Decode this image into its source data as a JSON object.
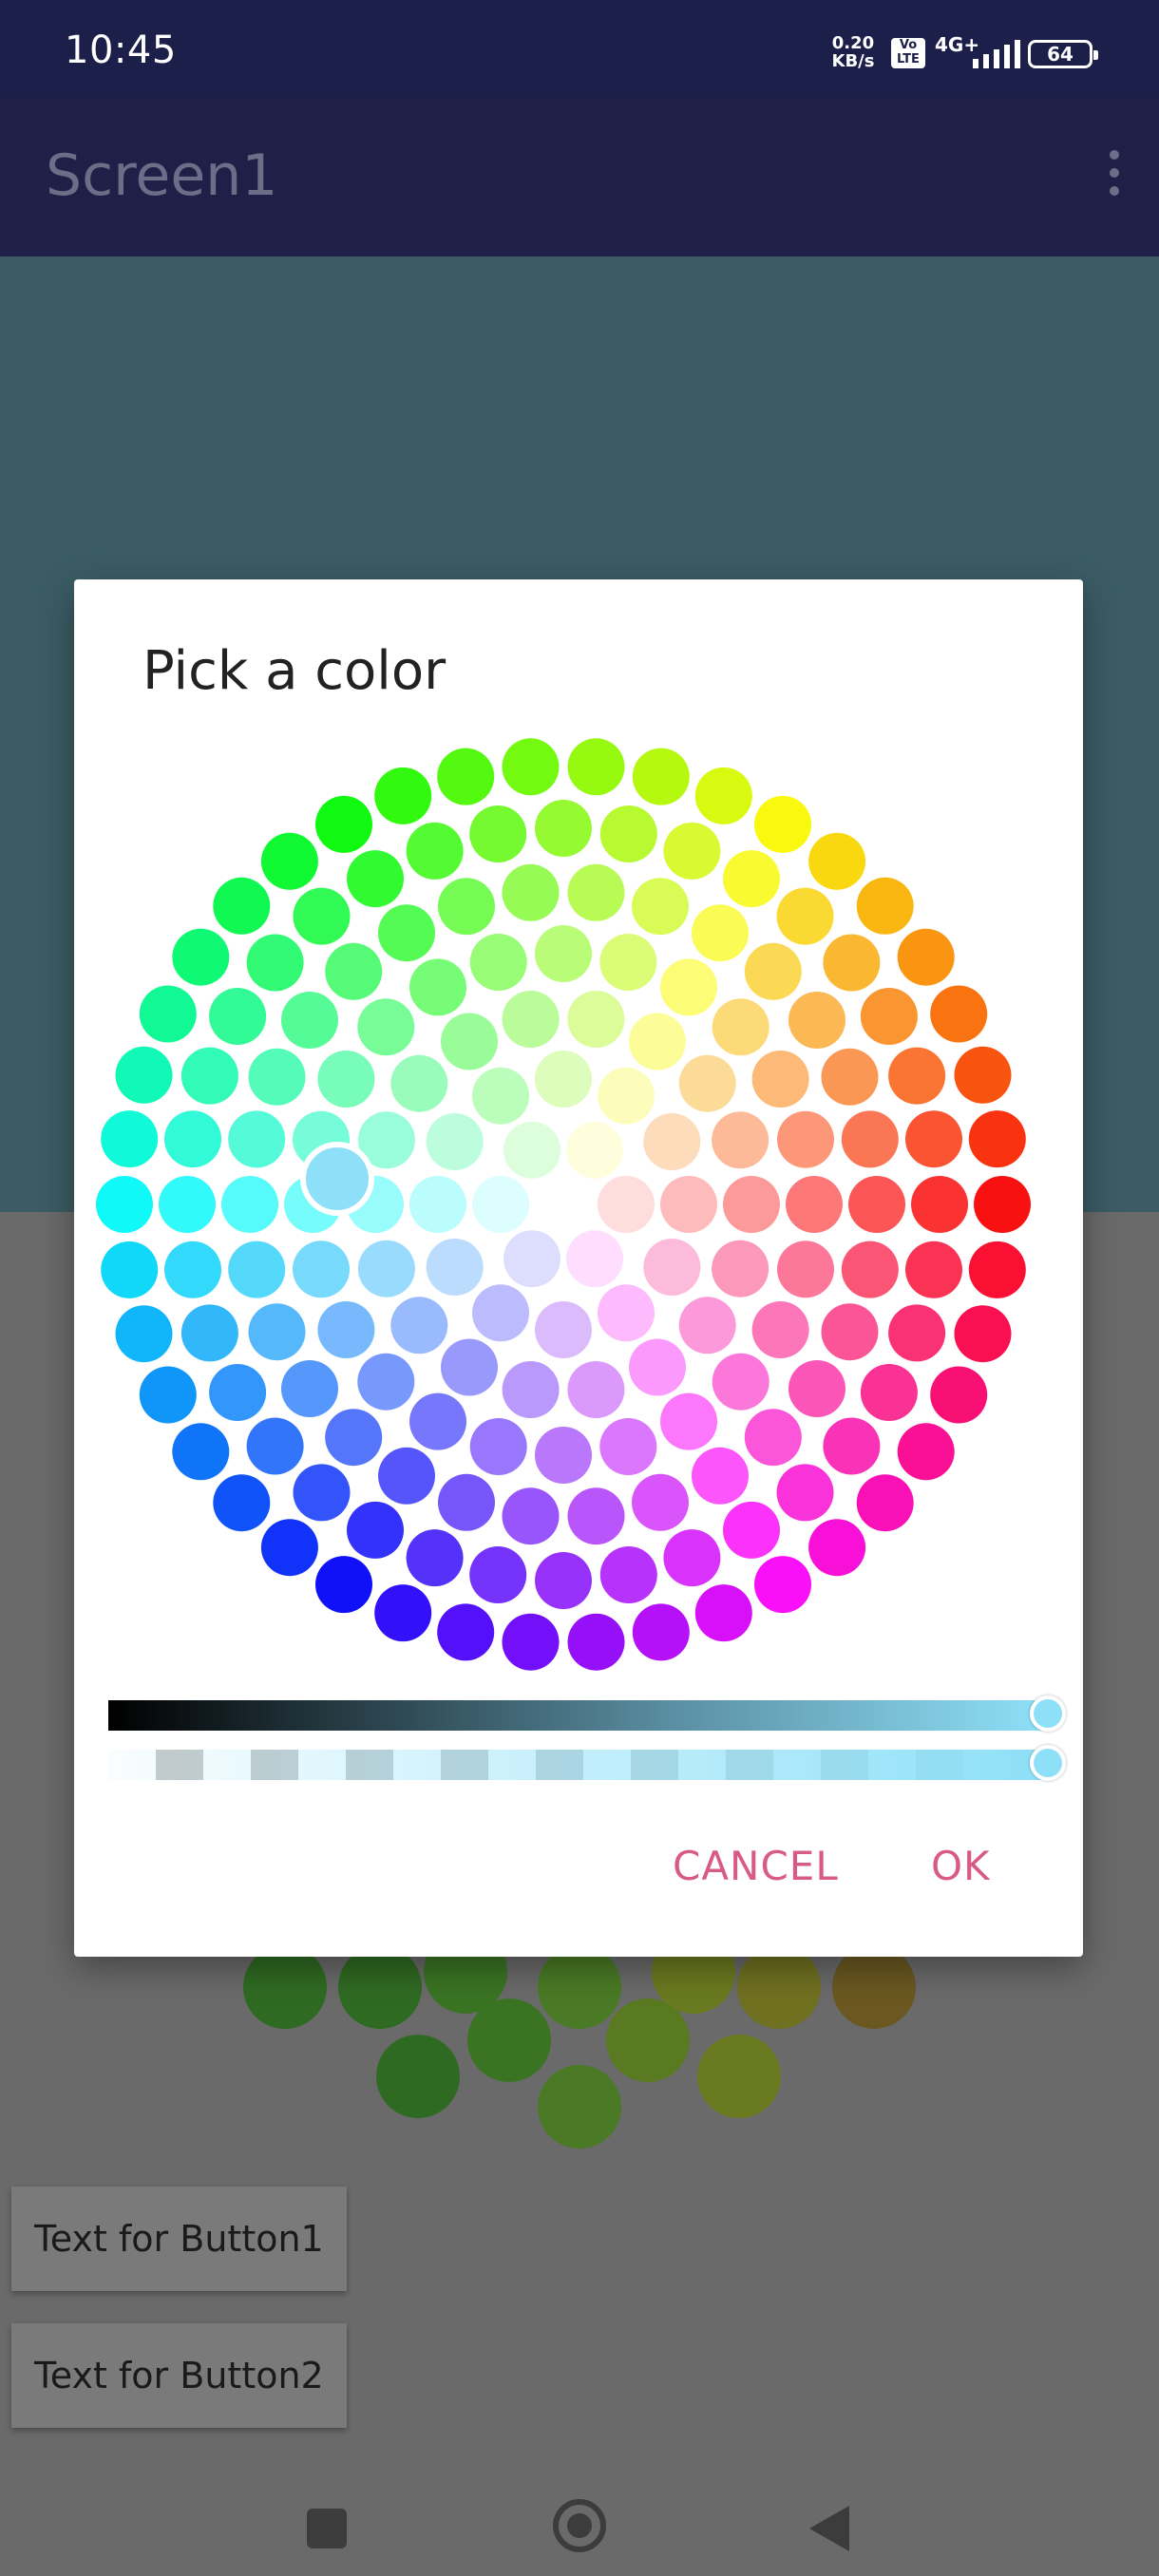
{
  "status_bar": {
    "time": "10:45",
    "net_speed_value": "0.20",
    "net_speed_unit": "KB/s",
    "volte_line1": "Vo",
    "volte_line2": "LTE",
    "network": "4G+",
    "battery": "64"
  },
  "app_bar": {
    "title": "Screen1",
    "menu_icon": "more-vert-icon"
  },
  "background": {
    "button1_label": "Text for Button1",
    "button2_label": "Text for Button2"
  },
  "dialog": {
    "title": "Pick a color",
    "cancel_label": "CANCEL",
    "ok_label": "OK",
    "selected_color": "#8ee0f8",
    "lightness_level": 1.0,
    "alpha_level": 1.0
  },
  "nav_bar": {
    "recents_icon": "recents-icon",
    "home_icon": "home-icon",
    "back_icon": "back-icon"
  }
}
